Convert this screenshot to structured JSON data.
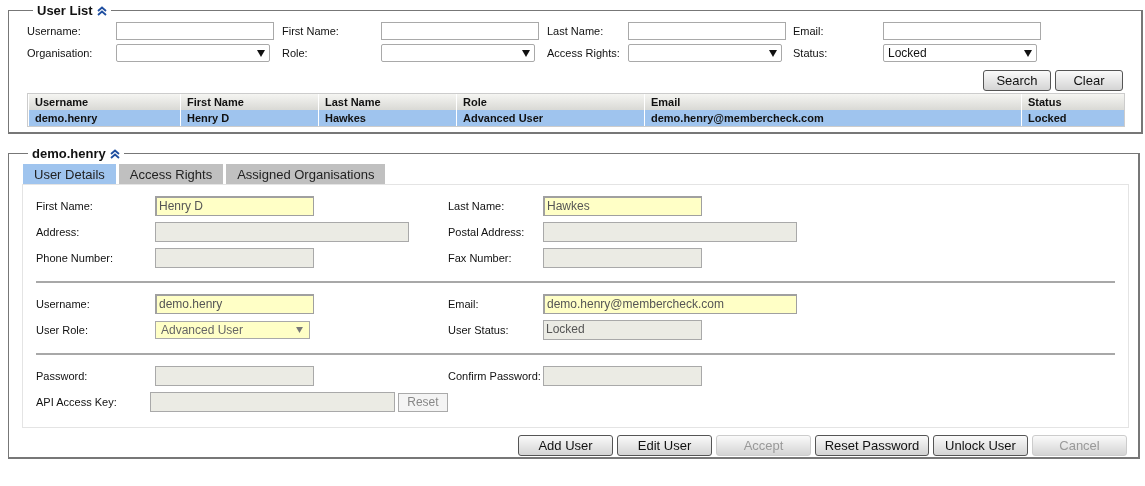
{
  "user_list": {
    "title": "User List",
    "filters": [
      {
        "label": "Username:",
        "kind": "input"
      },
      {
        "label": "First Name:",
        "kind": "input"
      },
      {
        "label": "Last Name:",
        "kind": "input"
      },
      {
        "label": "Email:",
        "kind": "input"
      },
      {
        "label": "Organisation:",
        "kind": "select"
      },
      {
        "label": "Role:",
        "kind": "select"
      },
      {
        "label": "Access Rights:",
        "kind": "select"
      },
      {
        "label": "Status:",
        "kind": "select",
        "value": "Locked"
      }
    ],
    "buttons": [
      {
        "label": "Search",
        "disabled": false
      },
      {
        "label": "Clear",
        "disabled": false
      }
    ],
    "table": {
      "columns": [
        "Username",
        "First Name",
        "Last Name",
        "Role",
        "Email",
        "Status"
      ],
      "rows": [
        {
          "cells": [
            "demo.henry",
            "Henry D",
            "Hawkes",
            "Advanced User",
            "demo.henry@membercheck.com",
            "Locked"
          ],
          "selected": true
        }
      ]
    }
  },
  "detail": {
    "title": "demo.henry",
    "tabs": [
      {
        "label": "User Details",
        "selected": true
      },
      {
        "label": "Access Rights",
        "selected": false
      },
      {
        "label": "Assigned Organisations",
        "selected": false
      }
    ],
    "groups": [
      [
        [
          {
            "label": "First Name:",
            "kind": "input",
            "value": "Henry D",
            "disabled": false
          },
          {
            "label": "Last Name:",
            "kind": "input",
            "value": "Hawkes",
            "disabled": false
          }
        ],
        [
          {
            "label": "Address:",
            "kind": "input",
            "disabled": true
          },
          {
            "label": "Postal Address:",
            "kind": "input",
            "disabled": true
          }
        ],
        [
          {
            "label": "Phone Number:",
            "kind": "input",
            "disabled": true
          },
          {
            "label": "Fax Number:",
            "kind": "input",
            "disabled": true
          }
        ]
      ],
      [
        [
          {
            "label": "Username:",
            "kind": "input",
            "value": "demo.henry",
            "disabled": false
          },
          {
            "label": "Email:",
            "kind": "input",
            "value": "demo.henry@membercheck.com",
            "disabled": false
          }
        ],
        [
          {
            "label": "User Role:",
            "kind": "select",
            "value": "Advanced User",
            "disabled": false
          },
          {
            "label": "User Status:",
            "kind": "input",
            "value": "Locked",
            "disabled": true
          }
        ]
      ],
      [
        [
          {
            "label": "Password:",
            "kind": "input",
            "disabled": true
          },
          {
            "label": "Confirm Password:",
            "kind": "input",
            "disabled": true
          }
        ],
        [
          {
            "label": "API Access Key:",
            "kind": "input",
            "disabled": true,
            "button": {
              "label": "Reset",
              "disabled": true
            }
          }
        ]
      ]
    ],
    "buttons": [
      {
        "label": "Add User",
        "disabled": false
      },
      {
        "label": "Edit User",
        "disabled": false
      },
      {
        "label": "Accept",
        "disabled": true
      },
      {
        "label": "Reset Password",
        "disabled": false
      },
      {
        "label": "Unlock User",
        "disabled": false
      },
      {
        "label": "Cancel",
        "disabled": true
      }
    ]
  }
}
